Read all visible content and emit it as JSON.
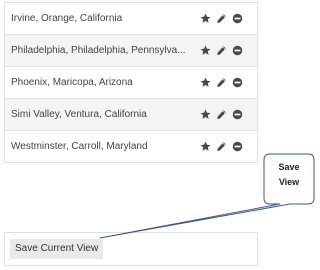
{
  "locations": [
    {
      "label": "Irvine, Orange, California"
    },
    {
      "label": "Philadelphia, Philadelphia, Pennsylva..."
    },
    {
      "label": "Phoenix, Maricopa, Arizona"
    },
    {
      "label": "Simi Valley, Ventura, California"
    },
    {
      "label": "Westminster, Carroll, Maryland"
    }
  ],
  "row_icons": [
    "star-icon",
    "pencil-icon",
    "minus-circle-icon"
  ],
  "save_button_label": "Save Current View",
  "callout": {
    "line1": "Save",
    "line2": "View"
  },
  "colors": {
    "icon": "#4a4a4a",
    "row_alt": "#f4f4f4",
    "border": "#e1e1e1",
    "callout_stroke": "#3b5a86"
  }
}
